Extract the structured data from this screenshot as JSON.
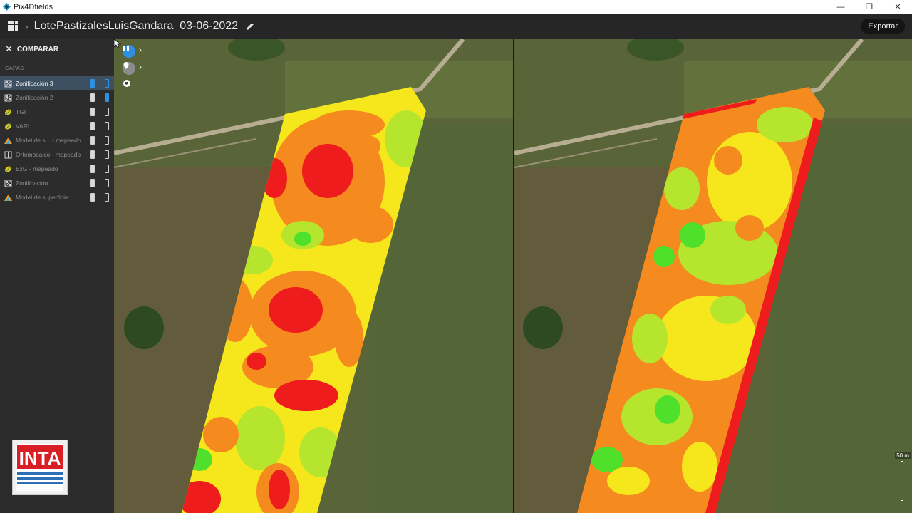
{
  "window": {
    "title": "Pix4Dfields"
  },
  "header": {
    "project_title": "LotePastizalesLuisGandara_03-06-2022",
    "export_label": "Exportar"
  },
  "sidebar": {
    "compare_label": "COMPARAR",
    "section_label": "CAPAS",
    "layers": [
      {
        "label": "Zonificación 3",
        "icon": "zoning-icon",
        "active": true
      },
      {
        "label": "Zonificación 2",
        "icon": "zoning-icon",
        "active": false
      },
      {
        "label": "TGI",
        "icon": "index-leaf-icon",
        "active": false
      },
      {
        "label": "VARI",
        "icon": "index-leaf-icon",
        "active": false
      },
      {
        "label": "Model de s... - mapeado",
        "icon": "surface-model-icon",
        "active": false
      },
      {
        "label": "Ortomosaico - mapeado",
        "icon": "orthomosaic-icon",
        "active": false
      },
      {
        "label": "ExG - mapeado",
        "icon": "index-leaf-icon",
        "active": false
      },
      {
        "label": "Zonificación",
        "icon": "zoning-icon",
        "active": false
      },
      {
        "label": "Model de superficie",
        "icon": "surface-model-icon",
        "active": false
      }
    ],
    "logo_text": "INTA"
  },
  "map": {
    "scale_label": "50 m"
  },
  "colors": {
    "accent": "#2f8fe0",
    "zone_red": "#ee1c1c",
    "zone_orange": "#f58a1f",
    "zone_yellow": "#f6e71d",
    "zone_light_green": "#b6e52d",
    "zone_green": "#4fe02b",
    "field_background": "#55633a"
  }
}
